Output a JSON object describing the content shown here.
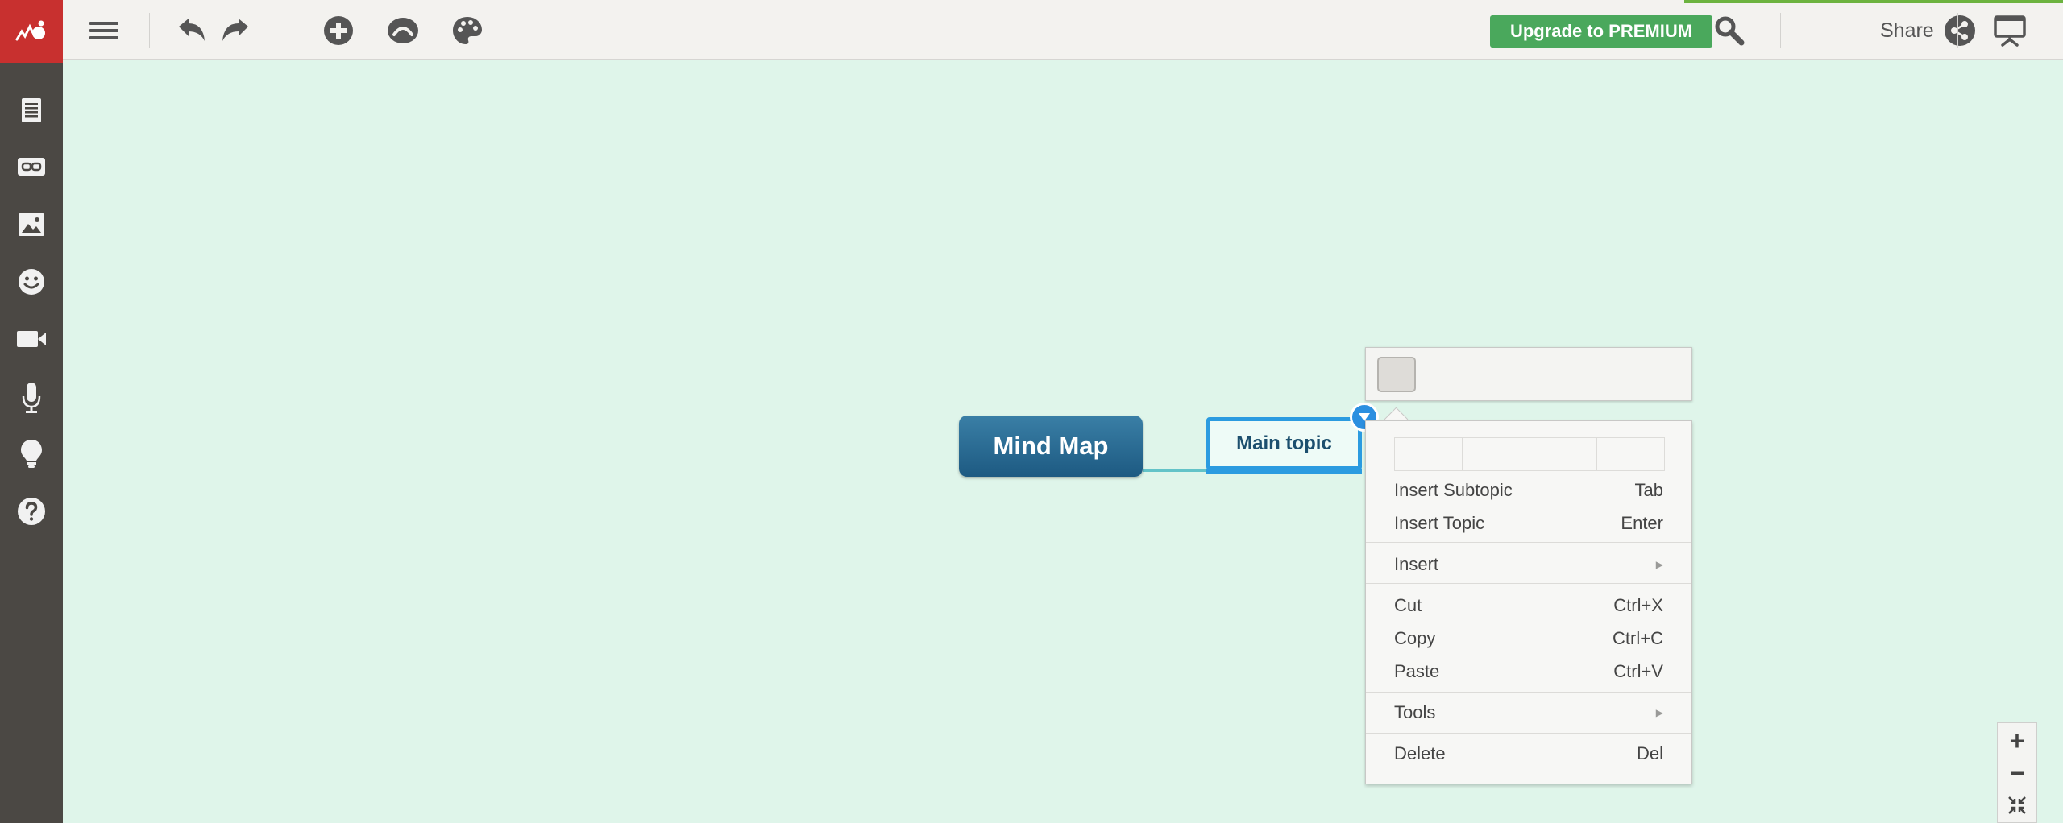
{
  "toolbar": {
    "premium_label": "Upgrade to PREMIUM",
    "share_label": "Share"
  },
  "canvas": {
    "root_node_label": "Mind Map",
    "topic_node_label": "Main topic"
  },
  "context_menu": {
    "items": [
      {
        "label": "Insert Subtopic",
        "shortcut": "Tab"
      },
      {
        "label": "Insert Topic",
        "shortcut": "Enter"
      },
      {
        "label": "Insert",
        "shortcut": ""
      },
      {
        "label": "Cut",
        "shortcut": "Ctrl+X"
      },
      {
        "label": "Copy",
        "shortcut": "Ctrl+C"
      },
      {
        "label": "Paste",
        "shortcut": "Ctrl+V"
      },
      {
        "label": "Tools",
        "shortcut": ""
      },
      {
        "label": "Delete",
        "shortcut": "Del"
      }
    ]
  },
  "zoom": {
    "zoom_in": "+",
    "zoom_out": "−"
  },
  "icons": {
    "sidebar": [
      "notes-icon",
      "link-icon",
      "image-icon",
      "smiley-icon",
      "video-icon",
      "microphone-icon",
      "lightbulb-icon",
      "help-icon"
    ],
    "toolbar": [
      "menu-icon",
      "undo-icon",
      "redo-icon",
      "add-topic-icon",
      "relation-icon",
      "palette-icon",
      "search-icon",
      "share-icon",
      "presentation-icon"
    ]
  },
  "colors": {
    "canvas_bg": "#dff5ea",
    "sidebar_bg": "#4b4844",
    "logo_bg": "#c8302f",
    "premium_green": "#4aa85c",
    "root_node_blue": "#1d5a82",
    "selection_blue": "#2b9be0"
  }
}
